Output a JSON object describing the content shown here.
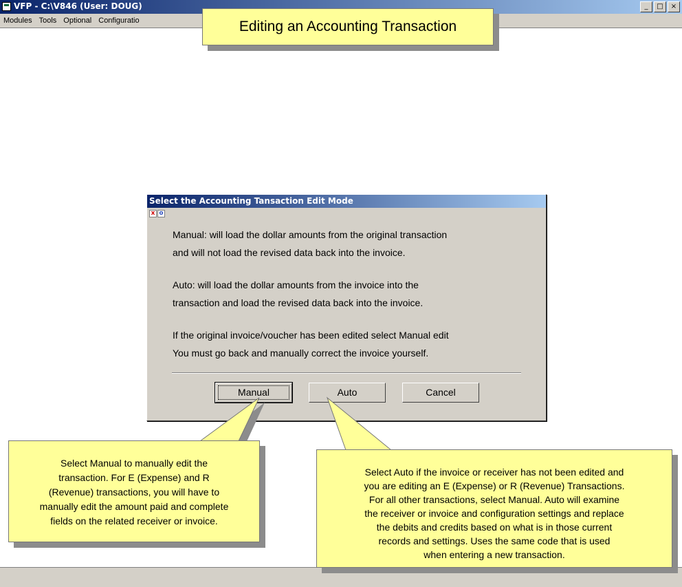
{
  "window": {
    "title": "VFP - C:\\V846  (User: DOUG)",
    "buttons": [
      "_",
      "□",
      "×"
    ]
  },
  "menu": [
    "Modules",
    "Tools",
    "Optional",
    "Configuratio"
  ],
  "title_callout": "Editing an Accounting Transaction",
  "dialog": {
    "title": "Select the Accounting Tansaction Edit Mode",
    "icons": [
      "x",
      "o"
    ],
    "lines": [
      "Manual:    will load the dollar amounts from the original transaction",
      "and will not load the revised data back into the invoice.",
      "Auto:        will load the dollar amounts from the invoice into the",
      "transaction and load the revised data back into the invoice.",
      "If the original invoice/voucher has been edited select Manual edit",
      "You must go back and manually correct the invoice yourself."
    ],
    "buttons": {
      "manual": "Manual",
      "auto": "Auto",
      "cancel": "Cancel"
    }
  },
  "callout_left": [
    "Select Manual to manually edit the",
    "transaction.  For E (Expense) and R",
    "(Revenue) transactions, you will have to",
    "manually edit the amount paid and complete",
    "fields on the related receiver or invoice."
  ],
  "callout_right": [
    "Select Auto if the invoice or receiver has not been edited and",
    "you are editing an E (Expense) or R (Revenue) Transactions.",
    "For all other transactions, select Manual.  Auto will examine",
    "the receiver or invoice and configuration settings and replace",
    "the debits and credits based on what is in those current",
    "records and settings.  Uses the same code that is used",
    "when entering a new transaction."
  ],
  "colors": {
    "titlebar": "#0a246a",
    "chrome": "#d4d0c8",
    "callout": "#ffff99"
  }
}
